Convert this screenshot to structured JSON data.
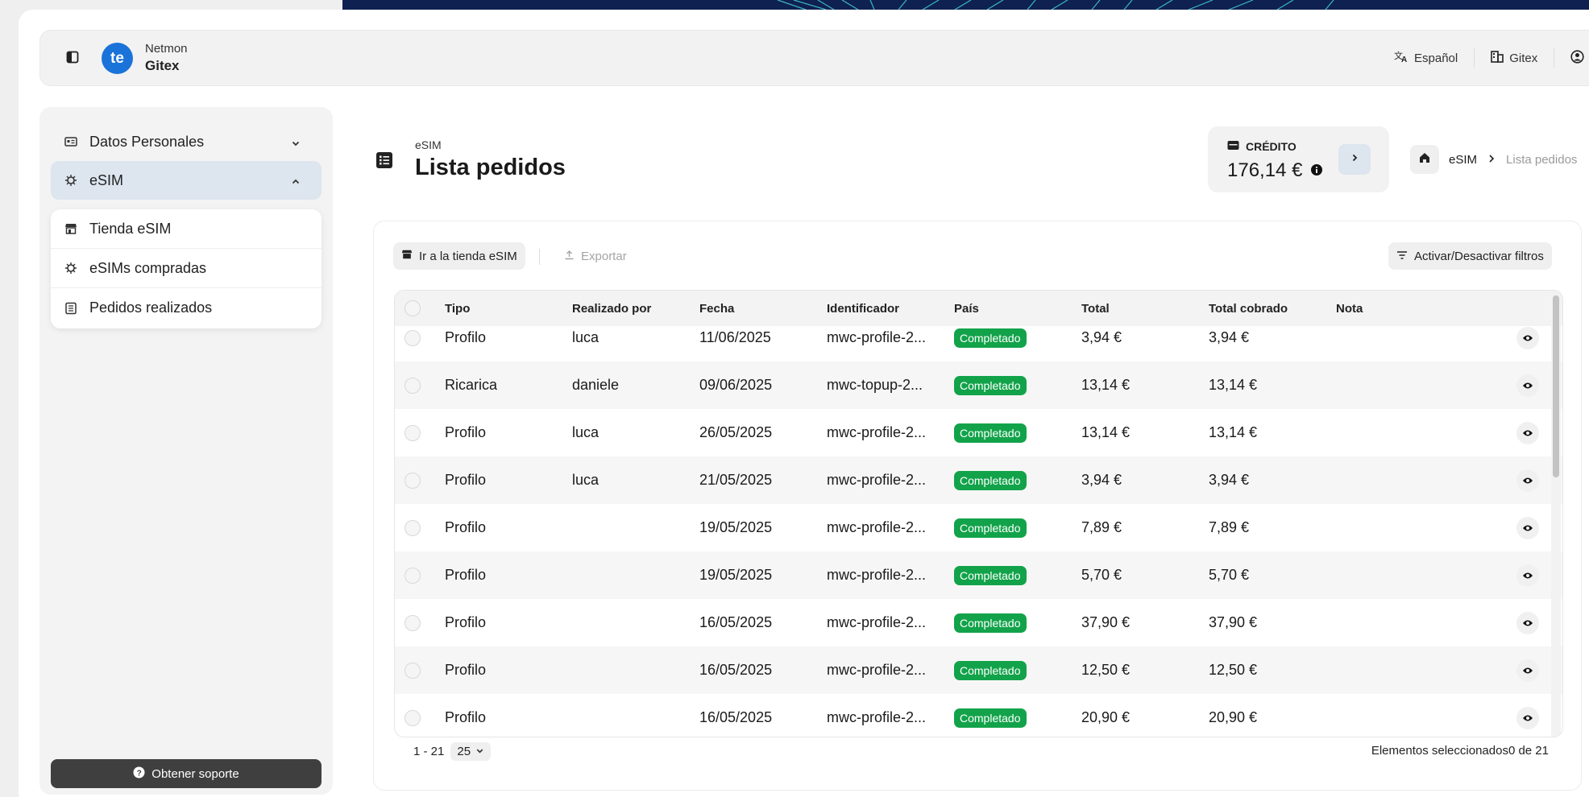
{
  "header": {
    "org_sub": "Netmon",
    "org_name": "Gitex",
    "logo_text": "te",
    "language": "Español",
    "company": "Gitex"
  },
  "sidebar": {
    "items": [
      {
        "label": "Datos Personales",
        "icon": "id-card-icon"
      },
      {
        "label": "eSIM",
        "icon": "chip-icon"
      }
    ],
    "submenu": [
      {
        "label": "Tienda eSIM",
        "icon": "store-icon"
      },
      {
        "label": "eSIMs compradas",
        "icon": "chip-icon"
      },
      {
        "label": "Pedidos realizados",
        "icon": "list-icon"
      }
    ],
    "support_label": "Obtener soporte"
  },
  "page": {
    "kicker": "eSIM",
    "title": "Lista pedidos"
  },
  "credit": {
    "label": "CRÉDITO",
    "value": "176,14 €"
  },
  "breadcrumb": {
    "parent": "eSIM",
    "current": "Lista pedidos"
  },
  "toolbar": {
    "store_label": "Ir a la tienda eSIM",
    "export_label": "Exportar",
    "filters_label": "Activar/Desactivar filtros"
  },
  "table": {
    "columns": [
      "Tipo",
      "Realizado por",
      "Fecha",
      "Identificador",
      "País",
      "Total",
      "Total cobrado",
      "Nota"
    ],
    "rows": [
      {
        "tipo": "Profilo",
        "por": "luca",
        "fecha": "11/06/2025",
        "id": "mwc-profile-2...",
        "estado": "Completado",
        "total": "3,94 €",
        "cobrado": "3,94 €"
      },
      {
        "tipo": "Ricarica",
        "por": "daniele",
        "fecha": "09/06/2025",
        "id": "mwc-topup-2...",
        "estado": "Completado",
        "total": "13,14 €",
        "cobrado": "13,14 €"
      },
      {
        "tipo": "Profilo",
        "por": "luca",
        "fecha": "26/05/2025",
        "id": "mwc-profile-2...",
        "estado": "Completado",
        "total": "13,14 €",
        "cobrado": "13,14 €"
      },
      {
        "tipo": "Profilo",
        "por": "luca",
        "fecha": "21/05/2025",
        "id": "mwc-profile-2...",
        "estado": "Completado",
        "total": "3,94 €",
        "cobrado": "3,94 €"
      },
      {
        "tipo": "Profilo",
        "por": "",
        "fecha": "19/05/2025",
        "id": "mwc-profile-2...",
        "estado": "Completado",
        "total": "7,89 €",
        "cobrado": "7,89 €"
      },
      {
        "tipo": "Profilo",
        "por": "",
        "fecha": "19/05/2025",
        "id": "mwc-profile-2...",
        "estado": "Completado",
        "total": "5,70 €",
        "cobrado": "5,70 €"
      },
      {
        "tipo": "Profilo",
        "por": "",
        "fecha": "16/05/2025",
        "id": "mwc-profile-2...",
        "estado": "Completado",
        "total": "37,90 €",
        "cobrado": "37,90 €"
      },
      {
        "tipo": "Profilo",
        "por": "",
        "fecha": "16/05/2025",
        "id": "mwc-profile-2...",
        "estado": "Completado",
        "total": "12,50 €",
        "cobrado": "12,50 €"
      },
      {
        "tipo": "Profilo",
        "por": "",
        "fecha": "16/05/2025",
        "id": "mwc-profile-2...",
        "estado": "Completado",
        "total": "20,90 €",
        "cobrado": "20,90 €"
      }
    ]
  },
  "footer": {
    "range": "1 - 21",
    "page_size": "25",
    "selected": "Elementos seleccionados0 de 21"
  }
}
